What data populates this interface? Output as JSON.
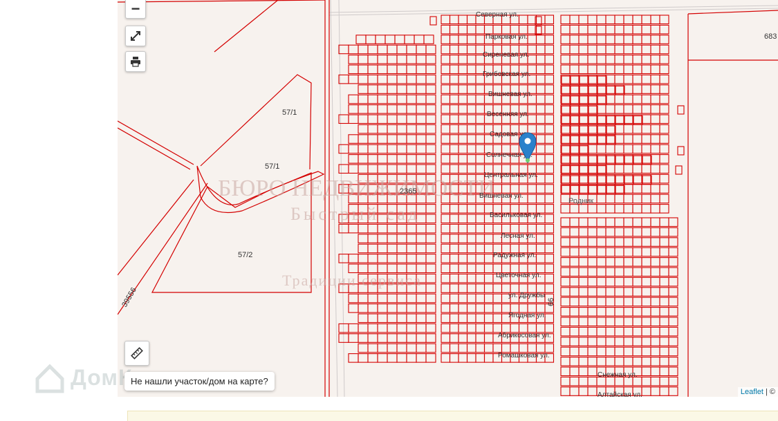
{
  "controls": {
    "zoom_out_label": "−",
    "fullscreen_icon": "expand-icon",
    "print_icon": "printer-icon",
    "ruler_icon": "ruler-icon"
  },
  "notfound_button": "Не нашли участок/дом на карте?",
  "attribution": {
    "leaflet": "Leaflet",
    "separator": " | ",
    "tail": "©"
  },
  "logo": {
    "text": "ДомКлик"
  },
  "watermark": {
    "line1": "БЮРО НЕДВИЖИМОСТИ",
    "line2": "Быстрый сад",
    "line3": "Традиции сервиса"
  },
  "parcel_labels": [
    "57/1",
    "57/1",
    "57/2",
    "2365",
    "683",
    "39556",
    "66"
  ],
  "place_label": "Родник",
  "streets": [
    "Северная ул.",
    "Парковая ул.",
    "Сиреневая ул.",
    "Грибовская ул.",
    "Вишневая ул.",
    "Весенняя ул.",
    "Садовая ул.",
    "Солнечная ул.",
    "Центральная ул.",
    "Вишневая ул.",
    "Васильковая ул.",
    "Лесная ул.",
    "Радужная ул.",
    "Цветочная ул.",
    "ул. Дружбы",
    "Ягодная ул.",
    "Абрикосовая ул.",
    "Ромашковая ул.",
    "Снежная ул.",
    "Алтайская ул."
  ],
  "colors": {
    "parcel_stroke": "#d40000",
    "map_bg": "#f7f2ee",
    "marker": "#2a81cb"
  }
}
